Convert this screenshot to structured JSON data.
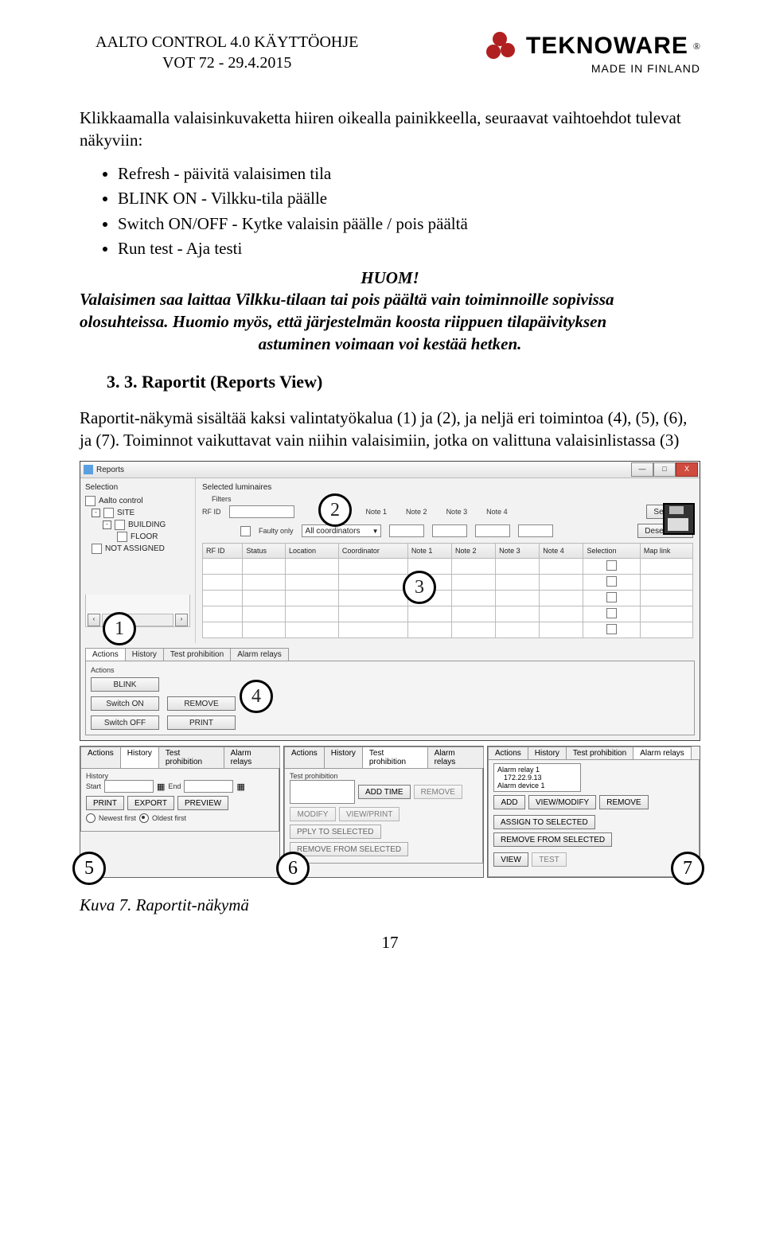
{
  "header": {
    "title_line1": "AALTO CONTROL 4.0 KÄYTTÖOHJE",
    "title_line2": "VOT 72 - 29.4.2015",
    "brand": "TEKNOWARE",
    "reg": "®",
    "made": "MADE IN FINLAND"
  },
  "intro": {
    "para": "Klikkaamalla valaisinkuvaketta hiiren oikealla painikkeella, seuraavat vaihtoehdot tulevat näkyviin:",
    "bullets": [
      "Refresh - päivitä valaisimen tila",
      "BLINK ON - Vilkku-tila päälle",
      "Switch ON/OFF - Kytke valaisin päälle / pois päältä",
      "Run test - Aja testi"
    ],
    "huom": "HUOM!",
    "note_line1": "Valaisimen saa laittaa Vilkku-tilaan tai pois päältä vain toiminnoille sopivissa olosuhteissa. Huomio myös, että järjestelmän koosta riippuen tilapäivityksen",
    "note_center": "astuminen voimaan voi kestää hetken."
  },
  "section": {
    "heading": "3. 3. Raportit (Reports View)",
    "para1": "Raportit-näkymä sisältää kaksi valintatyökalua (1) ja (2), ja neljä eri toimintoa (4), (5), (6), ja (7). Toiminnot vaikuttavat vain niihin valaisimiin, jotka on valittuna valaisinlistassa (3)"
  },
  "mainwin": {
    "title": "Reports",
    "selection": "Selection",
    "tree": {
      "n0": "Aalto control",
      "n1": "SITE",
      "n2": "BUILDING",
      "n3": "FLOOR",
      "n4": "NOT ASSIGNED"
    },
    "selected_luminaires": "Selected luminaires",
    "filters": "Filters",
    "rfid": "RF ID",
    "faulty": "Faulty only",
    "coord": "All coordinators",
    "note1": "Note 1",
    "note2": "Note 2",
    "note3": "Note 3",
    "note4": "Note 4",
    "selectall": "Select all",
    "deselectall": "Deselect all",
    "cols": {
      "rfid": "RF ID",
      "status": "Status",
      "location": "Location",
      "coordinator": "Coordinator",
      "n1": "Note 1",
      "n2": "Note 2",
      "n3": "Note 3",
      "n4": "Note 4",
      "selection": "Selection",
      "maplink": "Map link"
    },
    "tabs": {
      "actions": "Actions",
      "history": "History",
      "testp": "Test prohibition",
      "alarm": "Alarm relays"
    },
    "actions_lbl": "Actions",
    "btns": {
      "blink": "BLINK",
      "switchon": "Switch ON",
      "switchoff": "Switch OFF",
      "remove": "REMOVE",
      "print": "PRINT"
    }
  },
  "panel5": {
    "history": "History",
    "start": "Start",
    "end": "End",
    "print": "PRINT",
    "export": "EXPORT",
    "preview": "PREVIEW",
    "newest": "Newest first",
    "oldest": "Oldest first"
  },
  "panel6": {
    "testp": "Test prohibition",
    "addtime": "ADD TIME",
    "remove": "REMOVE",
    "modify": "MODIFY",
    "viewprint": "VIEW/PRINT",
    "apply": "PPLY TO SELECTED",
    "removefrom": "REMOVE FROM SELECTED"
  },
  "panel7": {
    "item1": "Alarm relay 1",
    "item1b": "172.22.9.13",
    "item2": "Alarm device 1",
    "add": "ADD",
    "viewmod": "VIEW/MODIFY",
    "remove": "REMOVE",
    "assign": "ASSIGN TO SELECTED",
    "removefrom": "REMOVE FROM SELECTED",
    "view": "VIEW",
    "test": "TEST"
  },
  "caption": "Kuva 7. Raportit-näkymä",
  "pagenum": "17"
}
